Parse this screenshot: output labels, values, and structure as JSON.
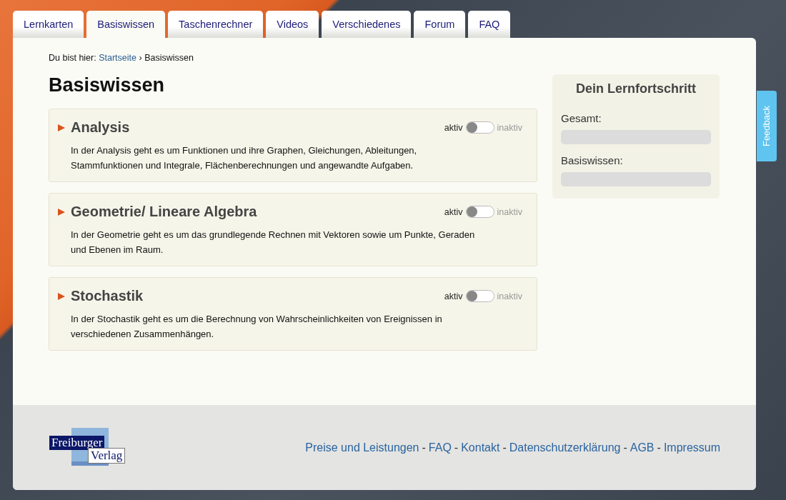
{
  "tabs": [
    {
      "label": "Lernkarten",
      "selected": false
    },
    {
      "label": "Basiswissen",
      "selected": true
    },
    {
      "label": "Taschenrechner",
      "selected": false
    },
    {
      "label": "Videos",
      "selected": false
    },
    {
      "label": "Verschiedenes",
      "selected": false
    },
    {
      "label": "Forum",
      "selected": false
    },
    {
      "label": "FAQ",
      "selected": false
    }
  ],
  "breadcrumb": {
    "prefix": "Du bist hier:",
    "link": "Startseite",
    "separator": "›",
    "current": "Basiswissen"
  },
  "title": "Basiswissen",
  "topics": [
    {
      "title": "Analysis",
      "on_label": "aktiv",
      "off_label": "inaktiv",
      "active": true,
      "text": "In der Analysis geht es um Funktionen und ihre Graphen, Gleichungen, Ableitungen, Stammfunktionen und Integrale, Flächenberechnungen und angewandte Aufgaben."
    },
    {
      "title": "Geometrie/ Lineare Algebra",
      "on_label": "aktiv",
      "off_label": "inaktiv",
      "active": true,
      "text": "In der Geometrie geht es um das grundlegende Rechnen mit Vektoren sowie um Punkte, Geraden und Ebenen im Raum."
    },
    {
      "title": "Stochastik",
      "on_label": "aktiv",
      "off_label": "inaktiv",
      "active": true,
      "text": "In der Stochastik geht es um die Berechnung von Wahrscheinlichkeiten von Ereignissen in verschiedenen Zusammenhängen."
    }
  ],
  "progress": {
    "title": "Dein Lernfortschritt",
    "items": [
      {
        "label": "Gesamt:",
        "level": 0
      },
      {
        "label": "Basiswissen:",
        "level": 0
      }
    ]
  },
  "feedback": "Feedback",
  "footer": {
    "logo": {
      "line1": "Freiburger",
      "line2": "Verlag"
    },
    "links": [
      {
        "kind": "link",
        "text": "Preise und Leistungen"
      },
      {
        "kind": "separator",
        "text": "-"
      },
      {
        "kind": "link",
        "text": "FAQ"
      },
      {
        "kind": "separator",
        "text": "-"
      },
      {
        "kind": "link",
        "text": "Kontakt"
      },
      {
        "kind": "separator",
        "text": "-"
      },
      {
        "kind": "link",
        "text": "Datenschutzerklärung"
      },
      {
        "kind": "separator",
        "text": "-"
      },
      {
        "kind": "link",
        "text": "AGB"
      },
      {
        "kind": "separator",
        "text": "-"
      },
      {
        "kind": "link",
        "text": "Impressum"
      }
    ]
  }
}
